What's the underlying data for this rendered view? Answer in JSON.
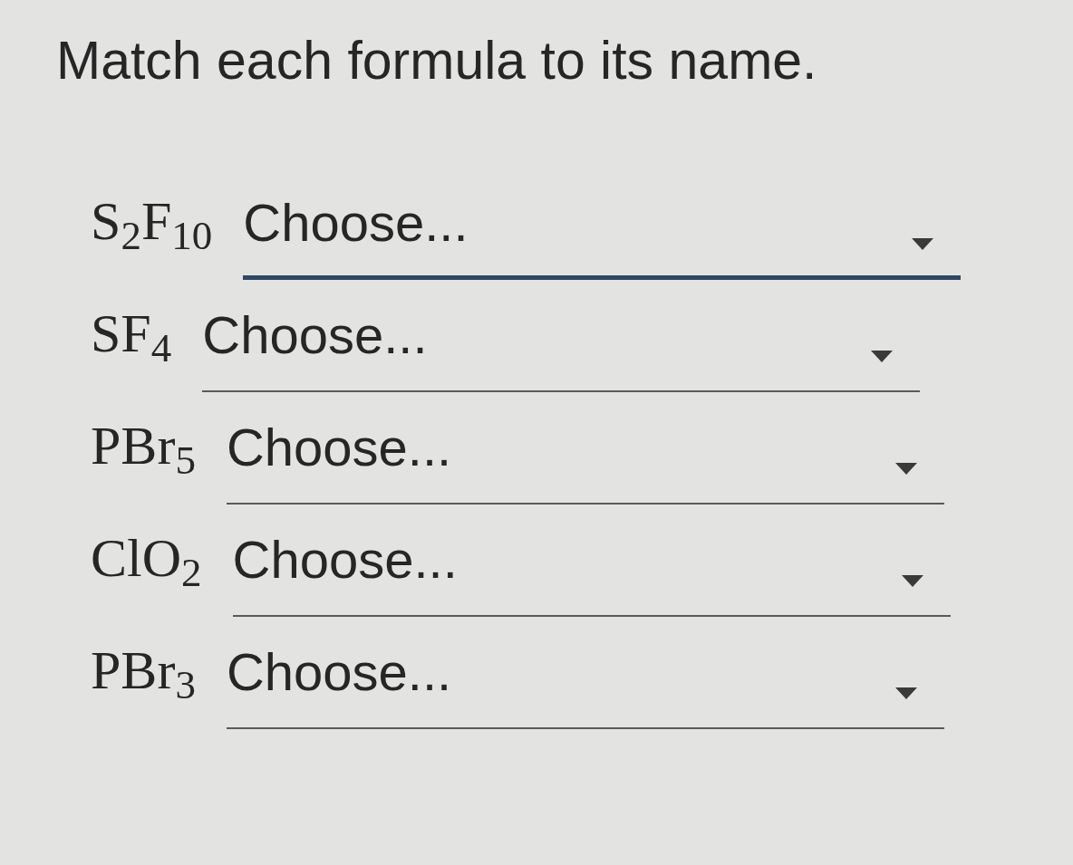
{
  "question": "Match each formula to its name.",
  "rows": [
    {
      "formula": "S$_{2}$F$_{10}$",
      "dropdown": {
        "value": "Choose...",
        "focused": true
      }
    },
    {
      "formula": "SF$_{4}$",
      "dropdown": {
        "value": "Choose...",
        "focused": false
      }
    },
    {
      "formula": "PBr$_{5}$",
      "dropdown": {
        "value": "Choose...",
        "focused": false
      }
    },
    {
      "formula": "ClO$_{2}$",
      "dropdown": {
        "value": "Choose...",
        "focused": false
      }
    },
    {
      "formula": "PBr$_{3}$",
      "dropdown": {
        "value": "Choose...",
        "focused": false
      }
    }
  ]
}
